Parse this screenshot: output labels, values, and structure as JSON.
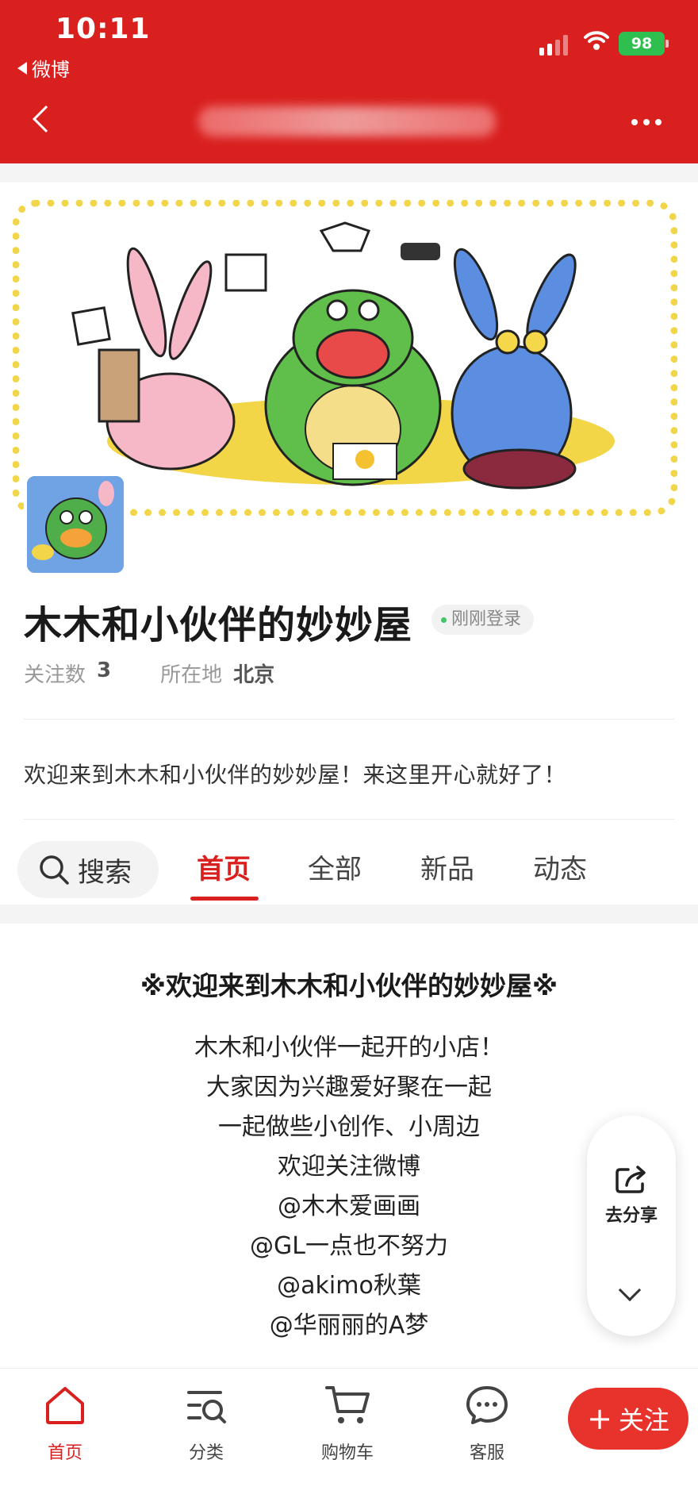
{
  "status_bar": {
    "time": "10:11",
    "back_app": "微博",
    "battery": "98"
  },
  "nav": {
    "title": "",
    "back_icon": "chevron-left-icon",
    "more_icon": "more-icon"
  },
  "shop": {
    "name": "木木和小伙伴的妙妙屋",
    "login_status": "刚刚登录",
    "follow_label": "关注数",
    "follow_count": "3",
    "location_label": "所在地",
    "location": "北京",
    "intro": "欢迎来到木木和小伙伴的妙妙屋！来这里开心就好了！"
  },
  "tabs": {
    "search": "搜索",
    "items": [
      "首页",
      "全部",
      "新品",
      "动态"
    ],
    "active": "首页"
  },
  "content": {
    "title": "※欢迎来到木木和小伙伴的妙妙屋※",
    "lines": [
      "木木和小伙伴一起开的小店！",
      "大家因为兴趣爱好聚在一起",
      "一起做些小创作、小周边",
      "欢迎关注微博",
      "@木木爱画画",
      "@GL一点也不努力",
      "@akimo秋葉",
      "@华丽丽的A梦"
    ]
  },
  "float": {
    "share": "去分享"
  },
  "bottom_nav": {
    "items": [
      "首页",
      "分类",
      "购物车",
      "客服"
    ],
    "follow": "关注"
  },
  "colors": {
    "brand_red": "#d9201f",
    "banner_dots": "#f1d64a"
  }
}
